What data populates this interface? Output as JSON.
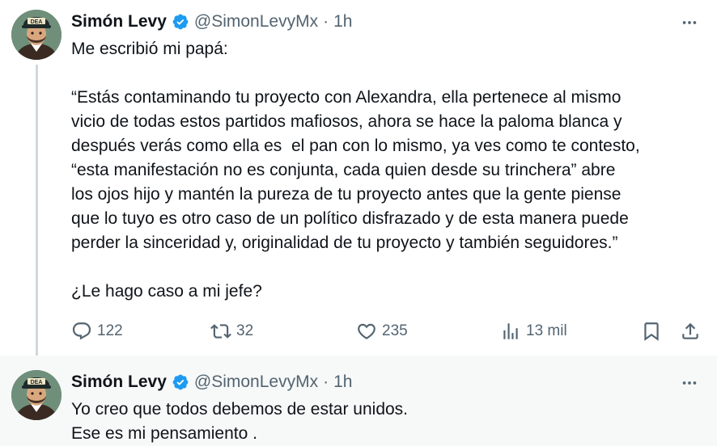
{
  "tweet1": {
    "author_name": "Simón Levy",
    "handle": "@SimonLevyMx",
    "separator": "·",
    "time": "1h",
    "paragraphs": [
      "Me escribió mi papá:",
      "“Estás contaminando tu proyecto con Alexandra, ella pertenece al mismo\nvicio de todas estos partidos mafiosos, ahora se hace la paloma blanca y\ndespués verás como ella es  el pan con lo mismo, ya ves como te contesto,\n“esta manifestación no es conjunta, cada quien desde su trinchera” abre\nlos ojos hijo y mantén la pureza de tu proyecto antes que la gente piense\nque lo tuyo es otro caso de un político disfrazado y de esta manera puede\nperder la sinceridad y, originalidad de tu proyecto y también seguidores.”",
      "¿Le hago caso a mi jefe?"
    ],
    "actions": {
      "replies": "122",
      "reposts": "32",
      "likes": "235",
      "views": "13 mil"
    },
    "avatar_badge": "DEA"
  },
  "tweet2": {
    "author_name": "Simón Levy",
    "handle": "@SimonLevyMx",
    "separator": "·",
    "time": "1h",
    "lines": [
      "Yo creo que todos debemos de estar unidos.",
      "Ese es mi pensamiento ."
    ],
    "avatar_badge": "DEA"
  },
  "icons": {
    "verified": "verified-badge-icon",
    "more": "more-icon",
    "reply": "reply-icon",
    "retweet": "retweet-icon",
    "like": "heart-icon",
    "views": "views-icon",
    "bookmark": "bookmark-icon",
    "share": "share-icon"
  },
  "colors": {
    "verified_blue": "#1d9bf0",
    "text": "#0f1419",
    "muted": "#536471",
    "thread_line": "#cfd9de",
    "reply_background": "#f7f9f9"
  }
}
